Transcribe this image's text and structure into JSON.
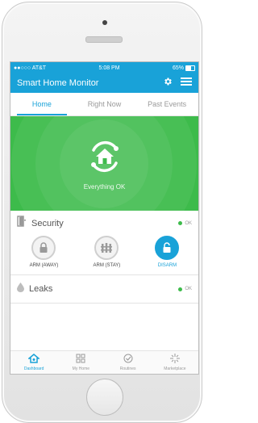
{
  "status": {
    "carrier": "●●○○○ AT&T",
    "time": "5:08 PM",
    "battery": "65%"
  },
  "app": {
    "title": "Smart Home Monitor"
  },
  "tabs": [
    {
      "label": "Home",
      "active": true
    },
    {
      "label": "Right Now",
      "active": false
    },
    {
      "label": "Past Events",
      "active": false
    }
  ],
  "hero": {
    "status_text": "Everything OK",
    "color": "#3dbb4b"
  },
  "security": {
    "title": "Security",
    "status": "OK",
    "modes": [
      {
        "label": "ARM (AWAY)",
        "icon": "lock-icon",
        "active": false
      },
      {
        "label": "ARM (STAY)",
        "icon": "fence-icon",
        "active": false
      },
      {
        "label": "DISARM",
        "icon": "unlock-icon",
        "active": true
      }
    ]
  },
  "leaks": {
    "title": "Leaks",
    "status": "OK"
  },
  "nav": [
    {
      "label": "Dashboard",
      "icon": "dashboard-icon",
      "active": true
    },
    {
      "label": "My Home",
      "icon": "grid-icon",
      "active": false
    },
    {
      "label": "Routines",
      "icon": "check-icon",
      "active": false
    },
    {
      "label": "Marketplace",
      "icon": "sparkle-icon",
      "active": false
    }
  ],
  "colors": {
    "accent": "#19a2d8",
    "ok": "#3dbb4b"
  }
}
